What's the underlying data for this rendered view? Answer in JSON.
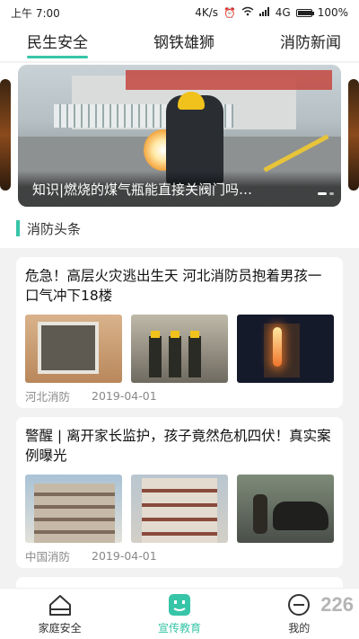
{
  "status_bar": {
    "time": "上午 7:00",
    "network_speed": "4K/s",
    "signal_label": "4G",
    "battery_pct": 100,
    "battery_label": "100%"
  },
  "top_tabs": [
    {
      "label": "民生安全",
      "active": true
    },
    {
      "label": "钢铁雄狮",
      "active": false
    },
    {
      "label": "消防新闻",
      "active": false
    }
  ],
  "banner": {
    "caption": "知识|燃烧的煤气瓶能直接关阀门吗…"
  },
  "section": {
    "title": "消防头条"
  },
  "news": [
    {
      "title": "危急！高层火灾逃出生天 河北消防员抱着男孩一口气冲下18楼",
      "source": "河北消防",
      "date": "2019-04-01",
      "images": [
        "window-photo",
        "firefighters-photo",
        "building-fire-night-photo"
      ]
    },
    {
      "title": "警醒 | 离开家长监护，孩子竟然危机四伏！真实案例曝光",
      "source": "中国消防",
      "date": "2019-04-01",
      "images": [
        "apartment-building-photo",
        "apartment-balcony-photo",
        "car-fire-photo"
      ]
    }
  ],
  "bottom_nav": [
    {
      "label": "家庭安全",
      "icon": "house-icon",
      "active": false
    },
    {
      "label": "宣传教育",
      "icon": "smiley-icon",
      "active": true
    },
    {
      "label": "我的",
      "icon": "profile-icon",
      "active": false
    }
  ],
  "watermark": "226",
  "colors": {
    "accent": "#37c5a8"
  }
}
